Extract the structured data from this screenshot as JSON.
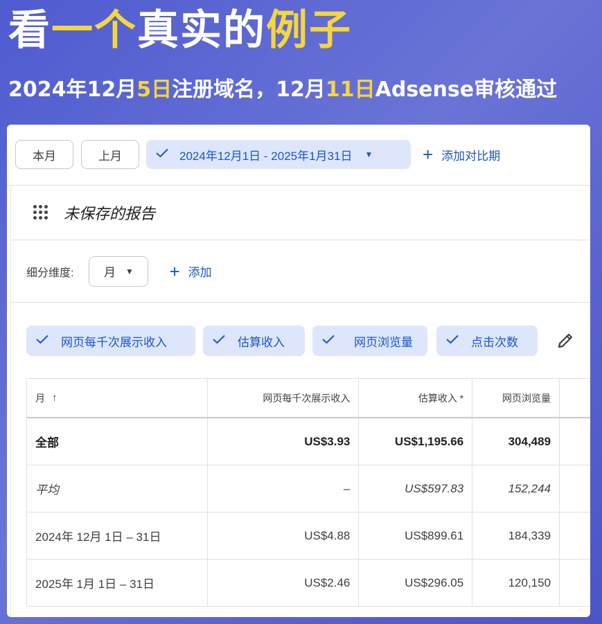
{
  "hero": {
    "title_prefix": "看",
    "title_hl1": "一个",
    "title_mid": "真实的",
    "title_hl2": "例子",
    "sub_part1": "2024年12月",
    "sub_hl1": "5日",
    "sub_part2": "注册域名，12月",
    "sub_hl2": "11日",
    "sub_part3": "Adsense审核通过"
  },
  "toolbar": {
    "this_month": "本月",
    "last_month": "上月",
    "date_range": "2024年12月1日 - 2025年1月31日",
    "add_compare": "添加对比期"
  },
  "report": {
    "title": "未保存的报告"
  },
  "breakdown": {
    "label": "细分维度:",
    "selected": "月",
    "add": "添加"
  },
  "metrics": [
    "网页每千次展示收入",
    "估算收入",
    "网页浏览量",
    "点击次数"
  ],
  "table": {
    "headers": [
      "月",
      "网页每千次展示收入",
      "估算收入 *",
      "网页浏览量"
    ],
    "rows": [
      [
        "全部",
        "US$3.93",
        "US$1,195.66",
        "304,489"
      ],
      [
        "平均",
        "–",
        "US$597.83",
        "152,244"
      ],
      [
        "2024年 12月 1日 – 31日",
        "US$4.88",
        "US$899.61",
        "184,339"
      ],
      [
        "2025年 1月 1日 – 31日",
        "US$2.46",
        "US$296.05",
        "120,150"
      ]
    ]
  },
  "colors": {
    "accent": "#1a56c9",
    "chip_bg": "#dde6fb",
    "highlight": "#f5d63d"
  }
}
